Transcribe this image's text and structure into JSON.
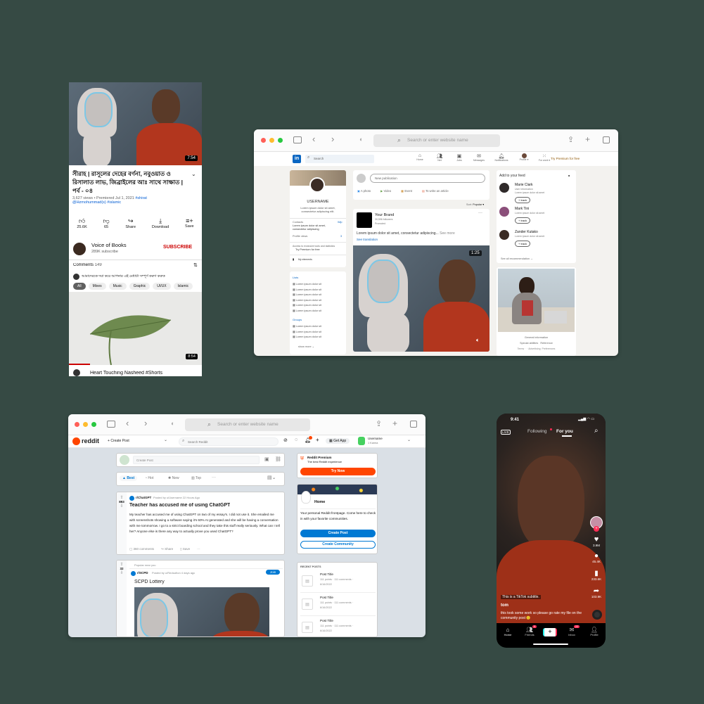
{
  "colors": {
    "bg": "#364a44",
    "linkedin": "#0a66c2",
    "reddit": "#ff4500",
    "youtube_red": "#cc0000"
  },
  "youtube": {
    "duration": "7:54",
    "title": "সীরাহ | রাসূলের  দেহের বর্ণনা, নবুওয়াত ও রিসালাত লাভ, জিব্রাইলের আঃ সাথে সাক্ষাত | পর্ব - ০৪",
    "meta_views": "3,627 views • Premiered Jul 1, 2021",
    "meta_tag1": "#shirat",
    "meta_tag2": "@Hzmohummad(s)",
    "meta_tag3": "#islamic",
    "actions": [
      {
        "icon": "thumb-up-icon",
        "label": "25.6K"
      },
      {
        "icon": "thumb-down-icon",
        "label": "65"
      },
      {
        "icon": "share-icon",
        "label": "Share"
      },
      {
        "icon": "download-icon",
        "label": "Download"
      },
      {
        "icon": "save-icon",
        "label": "Save"
      }
    ],
    "channel_name": "Voice of Books",
    "channel_subs": "289K subscribe",
    "subscribe": "SUBSCRIBE",
    "comments_label": "Comments",
    "comments_count": "149",
    "top_comment": "আমাদেরকে দয়া করে আপনার এই মেধাটা সম্পূর্ণ করুণ করুক",
    "chips": [
      "All",
      "Mixes",
      "Music",
      "Graphic",
      "UI/UX",
      "Islamic"
    ],
    "video2_duration": "8:54",
    "video2_title": "Heart Touching Nasheed #Shorts"
  },
  "linkedin": {
    "browser_url": "Search or enter website name",
    "search": "Search",
    "nav": [
      "Home",
      "Net",
      "Jobs",
      "Messages",
      "Notifications",
      "Profile ▾",
      "For work ▾"
    ],
    "premium": "Try Premium for free",
    "username": "USERNAME",
    "bio": "Lorem ipsum dolor sit amet, consectetur adipiscing elit.",
    "contacts_label": "Contacts",
    "contacts_val": "Wip",
    "contacts_desc": "Lorem ipsum dolor sit amet, consectetur adipiscing",
    "views_label": "Profile views",
    "views_val": "3",
    "access": "Access to exclusive tools and statistics",
    "try_premium": "Try Premium for free",
    "my_elements": "My elements",
    "lists_label": "Lists",
    "list_items": [
      "Lorem ipsum dolor sit",
      "Lorem ipsum dolor sit",
      "Lorem ipsum dolor sit",
      "Lorem ipsum dolor sit",
      "Lorem ipsum dolor sit",
      "Lorem ipsum dolor sit"
    ],
    "groups_label": "Groups",
    "group_items": [
      "Lorem ipsum dolor sit",
      "Lorem ipsum dolor sit",
      "Lorem ipsum dolor sit"
    ],
    "show_more": "show more",
    "new_pub": "New publication",
    "composer_actions": [
      "A photo",
      "Video",
      "Event",
      "To write an article"
    ],
    "sort_label": "Sort:",
    "sort_val": "Popular ▾",
    "brand": "Your Brand",
    "followers": "30,596 followers",
    "promoted": "Promoted",
    "post_text": "Lorem ipsum dolor sit amet, consectetur adipiscing...",
    "see_more": "See more",
    "see_translation": "See translation",
    "video_time": "1:25",
    "feed_title": "Add to your feed",
    "feed": [
      {
        "name": "Marie Clark",
        "desc": "User information",
        "sub": "Lorem ipsum dolor sit amet"
      },
      {
        "name": "Mark Tini",
        "desc": "Lorem ipsum dolor sit amet",
        "sub": ""
      },
      {
        "name": "Zander Kutako",
        "desc": "Lorem ipsum dolor sit amet",
        "sub": ""
      }
    ],
    "track": "+ track",
    "see_all": "See all recommendation →",
    "general": "General information",
    "footer_links": "Special abilities   Reference",
    "footer_links2": "Terms ·  · Advertising  Preferences"
  },
  "reddit": {
    "browser_url": "Search or enter website name",
    "logo": "reddit",
    "create_post": "Create Post",
    "search": "Search Reddit",
    "get_app": "Get App",
    "username": "Username",
    "karma": "1 Karma",
    "create_post_placeholder": "Create Post",
    "sort": [
      "Best",
      "Hot",
      "New",
      "Top"
    ],
    "post1": {
      "votes": "893",
      "community": "r/ChatGPT",
      "posted": "Posted by u/Username 22 Hours Ago",
      "title": "Teacher has accused me of using ChatGPT",
      "body": "My teacher has accused me of using ChatGPT on two of my essay's. I did not use it. She emailed me with screenshots showing a software saying it's 60% AI generated and she will be having a conversation with me tommorrow. I go to a strict boarding school and they take this stuff really seriously. What can I tell her? Anyone else is there any way to actually prove you used ChatGPT?",
      "comments": "360 comments",
      "share": "Share",
      "save": "Save"
    },
    "post2": {
      "votes": "32",
      "popular": "Popular near you",
      "community": "r/SCPD",
      "posted": "Posted by u/Redsafron 4 days ago",
      "join": "Join",
      "title": "SCPD Lottery"
    },
    "premium_title": "Reddit Premium",
    "premium_desc": "The best Reddit experience",
    "try_now": "Try Now",
    "home_title": "Home",
    "home_desc": "Your personal Reddit frontpage. Come here to check in with your favorite communities.",
    "home_create_post": "Create Post",
    "create_community": "Create Community",
    "recent_label": "RECENT POSTS",
    "recent": [
      {
        "title": "Post Title",
        "meta": "111 points · 111 comments ·",
        "date": "6/16/2022"
      },
      {
        "title": "Post Title",
        "meta": "111 points · 111 comments ·",
        "date": "6/16/2022"
      },
      {
        "title": "Post Title",
        "meta": "111 points · 111 comments ·",
        "date": "6/16/2022"
      }
    ]
  },
  "tiktok": {
    "time": "9:41",
    "live": "LIVE",
    "following": "Following",
    "for_you": "For you",
    "likes": "3.9M",
    "comments": "45.4K",
    "saves": "233.6K",
    "shares": "103.9K",
    "subtitle": "This is a TikTok subtitle.",
    "user": "tom",
    "desc": "this took some work so please go rate my file on the community post 🙂",
    "tabs": [
      "Home",
      "Friends",
      "Inbox",
      "Profile"
    ],
    "friends_badge": "9",
    "inbox_badge": "22"
  }
}
